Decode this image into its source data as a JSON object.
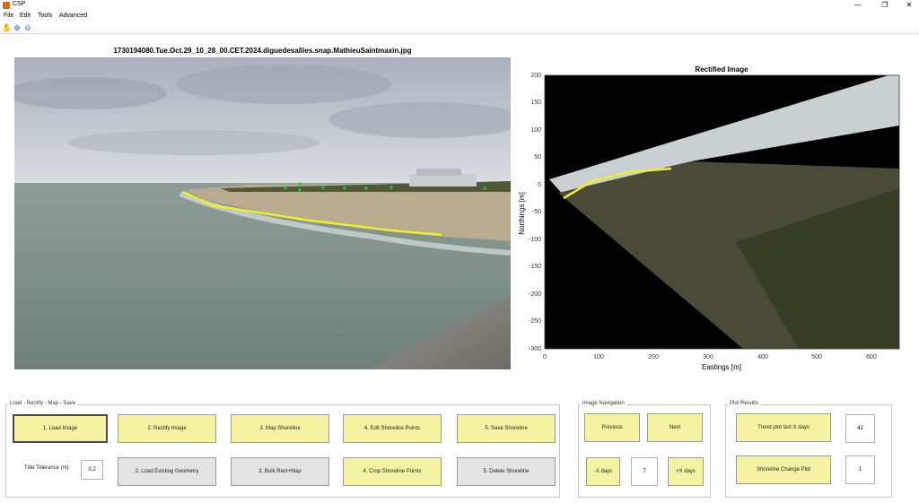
{
  "window": {
    "title": "CSP",
    "minimize": "—",
    "restore": "❐",
    "close": "✕"
  },
  "menu": [
    "File",
    "Edit",
    "Tools",
    "Advanced"
  ],
  "toolbar_icons": [
    "pan-icon",
    "zoom-in-icon",
    "zoom-out-icon"
  ],
  "image": {
    "title": "1730194080.Tue.Oct.29_10_28_00.CET.2024.diguedesallies.snap.MathieuSaintmaxin.jpg"
  },
  "rectified": {
    "title": "Rectified Image",
    "xlabel": "Eastings [m]",
    "ylabel": "Northings [m]",
    "xticks": [
      "0",
      "100",
      "200",
      "300",
      "400",
      "500",
      "600"
    ],
    "yticks": [
      "200",
      "150",
      "100",
      "50",
      "0",
      "-50",
      "-100",
      "-150",
      "-200",
      "-250",
      "-300"
    ]
  },
  "panels": {
    "load": {
      "title": "Load - Rectify - Map - Save",
      "b1": "1. Load Image",
      "b2": "2. Rectify Image",
      "b3": "3. Map Shoreline",
      "b4": "4. Edit Shoreline Points",
      "b5": "5. Save Shoreline",
      "tide_label": "Tide Tolerance (m)",
      "tide_value": "0.2",
      "b6": "2. Load Existing Geometry",
      "b7": "3. Bulk Rect+Map",
      "b8": "4. Crop Shoreline Points",
      "b9": "5. Delete Shoreline"
    },
    "nav": {
      "title": "Image Navigation",
      "previous": "Previous",
      "next": "Next",
      "minus_days": "-X days",
      "days_value": "7",
      "plus_days": "+X days"
    },
    "results": {
      "title": "Plot Results",
      "trend": "Trend plot last X days",
      "trend_value": "42",
      "change": "Shoreline Change Plot",
      "change_value": "1"
    }
  },
  "colors": {
    "button_yellow": "#f5f3a2",
    "button_gray": "#e3e3e3",
    "shoreline": "#f2ee2a"
  }
}
